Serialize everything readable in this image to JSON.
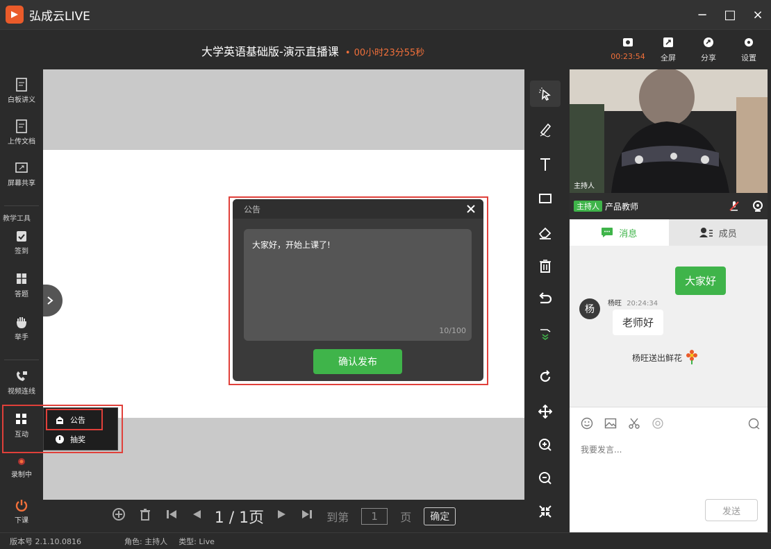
{
  "app": {
    "name": "弘成云LIVE",
    "window_controls": [
      "−",
      "□",
      "×"
    ]
  },
  "header": {
    "course_title": "大学英语基础版-演示直播课",
    "dot": "•",
    "elapsed": "00小时23分55秒",
    "tools": [
      {
        "icon": "record-icon",
        "label": "00:23:54"
      },
      {
        "icon": "fullscreen-icon",
        "label": "全屏"
      },
      {
        "icon": "share-icon",
        "label": "分享"
      },
      {
        "icon": "settings-icon",
        "label": "设置"
      }
    ]
  },
  "sidebar": {
    "items": [
      {
        "icon": "whiteboard-icon",
        "label": "白板讲义"
      },
      {
        "icon": "upload-doc-icon",
        "label": "上传文档"
      },
      {
        "icon": "screen-share-icon",
        "label": "屏幕共享"
      }
    ],
    "section_label": "教学工具",
    "teaching": [
      {
        "icon": "checkin-icon",
        "label": "签到"
      },
      {
        "icon": "quiz-icon",
        "label": "答题"
      },
      {
        "icon": "raise-hand-icon",
        "label": "举手"
      }
    ],
    "video_link": "视频连线",
    "interact": "互动",
    "recording": "录制中",
    "end_class": "下课"
  },
  "popup_menu": {
    "items": [
      {
        "icon": "notice-icon",
        "label": "公告"
      },
      {
        "icon": "lottery-icon",
        "label": "抽奖"
      }
    ]
  },
  "notice_dialog": {
    "title": "公告",
    "content": "大家好，开始上课了!",
    "counter": "10/100",
    "confirm": "确认发布"
  },
  "pager": {
    "current": "1",
    "page_text": "1 / 1页",
    "goto_prefix": "到第",
    "goto_suffix": "页",
    "ok": "确定"
  },
  "right_panel": {
    "video_label": "主持人",
    "host_badge": "主持人",
    "host_name": "产品教师",
    "tabs": [
      {
        "label": "消息"
      },
      {
        "label": "成员"
      }
    ],
    "messages": {
      "mine": "大家好",
      "avatar_char": "杨",
      "sender": "杨旺",
      "time": "20:24:34",
      "text": "老师好",
      "gift": "杨旺送出鲜花"
    },
    "input_placeholder": "我要发言...",
    "send": "发送"
  },
  "status": {
    "version": "版本号 2.1.10.0816",
    "role": "角色: 主持人",
    "type": "类型: Live"
  },
  "colors": {
    "accent": "#3fb44a",
    "highlight": "#e0403a",
    "timer": "#f2703a"
  }
}
